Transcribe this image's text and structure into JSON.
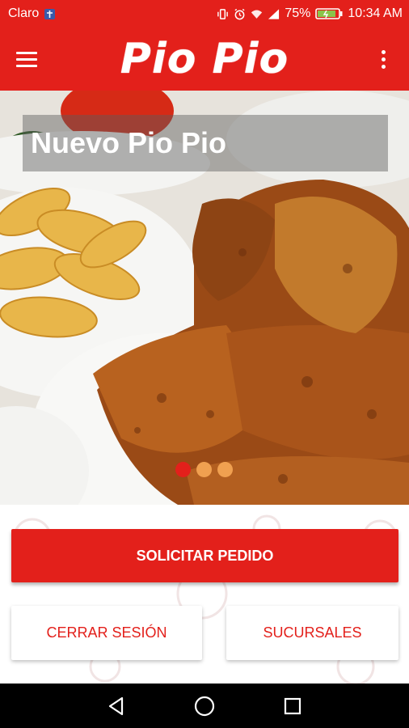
{
  "status_bar": {
    "carrier": "Claro",
    "battery_percent": "75%",
    "time": "10:34 AM"
  },
  "app_bar": {
    "logo_text": "Pio Pio"
  },
  "carousel": {
    "caption": "Nuevo Pio Pio",
    "slide_count": 3,
    "active_slide": 1
  },
  "actions": {
    "order_label": "SOLICITAR PEDIDO",
    "logout_label": "CERRAR SESIÓN",
    "branches_label": "SUCURSALES"
  },
  "colors": {
    "brand_red": "#e3201b",
    "dot_inactive": "#f0a050"
  },
  "icons": {
    "menu": "menu-icon",
    "more": "more-vert-icon",
    "back": "back-icon",
    "home": "home-icon",
    "recents": "recents-icon"
  }
}
